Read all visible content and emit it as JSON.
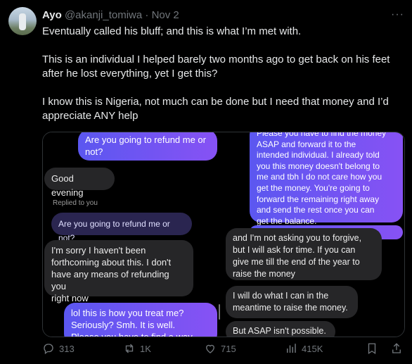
{
  "tweet": {
    "display_name": "Ayo",
    "handle": "@akanji_tomiwa",
    "separator": "·",
    "date": "Nov 2",
    "paragraphs": [
      "Eventually called his bluff; and this is what I’m met with.",
      "This is an individual I helped barely two months ago to get back on his feet after he lost everything, yet I get this?",
      "I know this is Nigeria, not much can be done but I need that money and I’d appreciate ANY help"
    ]
  },
  "chat_left": {
    "sent_top": "Are you going to refund me or\nnot?",
    "good_evening": "Good evening",
    "replied_label": "Replied to you",
    "quoted": "Are you going to refund me or not?",
    "reply": "I'm sorry I haven't been\nforthcoming about this. I don't\nhave any means of refunding you\nright now",
    "sent_bottom": "lol this is how you treat me?\nSeriously? Smh. It is well.\nPlease you have to find a way"
  },
  "chat_right": {
    "sent": "Please you have to find the money\nASAP and forward it to the\nintended individual.  I already told\nyou this money doesn't belong to\nme and tbh I do not care how you\nget the money. You're going to\nforward the remaining right away\nand send the rest once you can\nget the balance.",
    "reply1": "and I'm not asking you to forgive,\nbut I will ask for time. If you can\ngive me till the end of the year to\nraise the money",
    "reply2": "I will do what I can in the\nmeantime to raise the money.",
    "reply3": "But ASAP isn't possible."
  },
  "actions": {
    "replies": "313",
    "reposts": "1K",
    "likes": "715",
    "views": "415K"
  },
  "icons": [
    "reply-icon",
    "repost-icon",
    "like-icon",
    "views-icon",
    "bookmark-icon",
    "share-icon",
    "more-icon"
  ]
}
